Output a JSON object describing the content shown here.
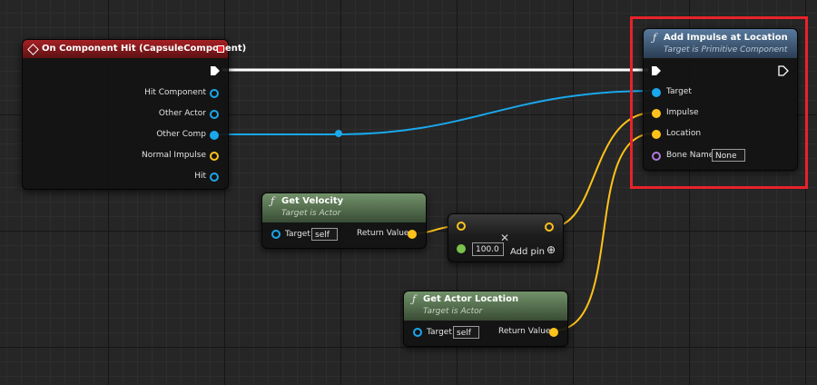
{
  "nodes": {
    "on_component_hit": {
      "title": "On Component Hit (CapsuleComponent)",
      "pins": [
        "Hit Component",
        "Other Actor",
        "Other Comp",
        "Normal Impulse",
        "Hit"
      ]
    },
    "add_impulse": {
      "title": "Add Impulse at Location",
      "subtitle": "Target is Primitive Component",
      "pins": [
        "Target",
        "Impulse",
        "Location",
        "Bone Name"
      ],
      "bone_name_value": "None"
    },
    "get_velocity": {
      "title": "Get Velocity",
      "subtitle": "Target is Actor",
      "target_label": "Target",
      "target_value": "self",
      "return_label": "Return Value"
    },
    "multiply": {
      "value": "100.0",
      "add_pin_label": "Add pin",
      "close_glyph": "✕"
    },
    "get_actor_location": {
      "title": "Get Actor Location",
      "subtitle": "Target is Actor",
      "target_label": "Target",
      "target_value": "self",
      "return_label": "Return Value"
    }
  },
  "icons": {
    "function_glyph": "ƒ",
    "plus_circle": "⊕"
  },
  "colors": {
    "exec_wire": "#ffffff",
    "object_pin": "#1aa7ec",
    "vector_pin": "#ffc21a",
    "name_pin": "#b07ad8",
    "float_pin": "#7ac24c",
    "highlight": "#e8222a"
  }
}
